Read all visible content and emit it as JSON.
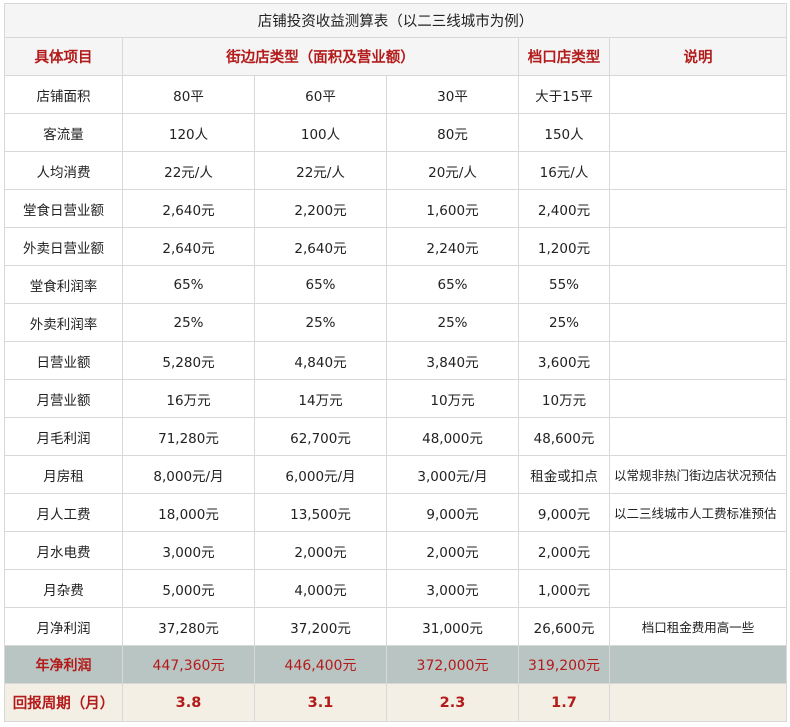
{
  "title": "店铺投资收益测算表（以二三线城市为例）",
  "header": {
    "item": "具体项目",
    "street_type": "街边店类型（面积及营业额）",
    "stall_type": "档口店类型",
    "notes": "说明"
  },
  "rows": [
    {
      "label": "店铺面积",
      "cells": [
        "80平",
        "60平",
        "30平",
        "大于15平"
      ],
      "note": ""
    },
    {
      "label": "客流量",
      "cells": [
        "120人",
        "100人",
        "80元",
        "150人"
      ],
      "note": ""
    },
    {
      "label": "人均消费",
      "cells": [
        "22元/人",
        "22元/人",
        "20元/人",
        "16元/人"
      ],
      "note": ""
    },
    {
      "label": "堂食日营业额",
      "cells": [
        "2,640元",
        "2,200元",
        "1,600元",
        "2,400元"
      ],
      "note": ""
    },
    {
      "label": "外卖日营业额",
      "cells": [
        "2,640元",
        "2,640元",
        "2,240元",
        "1,200元"
      ],
      "note": ""
    },
    {
      "label": "堂食利润率",
      "cells": [
        "65%",
        "65%",
        "65%",
        "55%"
      ],
      "note": ""
    },
    {
      "label": "外卖利润率",
      "cells": [
        "25%",
        "25%",
        "25%",
        "25%"
      ],
      "note": ""
    },
    {
      "label": "日营业额",
      "cells": [
        "5,280元",
        "4,840元",
        "3,840元",
        "3,600元"
      ],
      "note": ""
    },
    {
      "label": "月营业额",
      "cells": [
        "16万元",
        "14万元",
        "10万元",
        "10万元"
      ],
      "note": ""
    },
    {
      "label": "月毛利润",
      "cells": [
        "71,280元",
        "62,700元",
        "48,000元",
        "48,600元"
      ],
      "note": ""
    },
    {
      "label": "月房租",
      "cells": [
        "8,000元/月",
        "6,000元/月",
        "3,000元/月",
        "租金或扣点"
      ],
      "note": "以常规非热门街边店状况预估"
    },
    {
      "label": "月人工费",
      "cells": [
        "18,000元",
        "13,500元",
        "9,000元",
        "9,000元"
      ],
      "note": "以二三线城市人工费标准预估"
    },
    {
      "label": "月水电费",
      "cells": [
        "3,000元",
        "2,000元",
        "2,000元",
        "2,000元"
      ],
      "note": ""
    },
    {
      "label": "月杂费",
      "cells": [
        "5,000元",
        "4,000元",
        "3,000元",
        "1,000元"
      ],
      "note": ""
    },
    {
      "label": "月净利润",
      "cells": [
        "37,280元",
        "37,200元",
        "31,000元",
        "26,600元"
      ],
      "note": "档口租金费用高一些"
    }
  ],
  "annual": {
    "label": "年净利润",
    "cells": [
      "447,360元",
      "446,400元",
      "372,000元",
      "319,200元"
    ],
    "note": ""
  },
  "payback": {
    "label": "回报周期（月）",
    "cells": [
      "3.8",
      "3.1",
      "2.3",
      "1.7"
    ],
    "note": ""
  }
}
